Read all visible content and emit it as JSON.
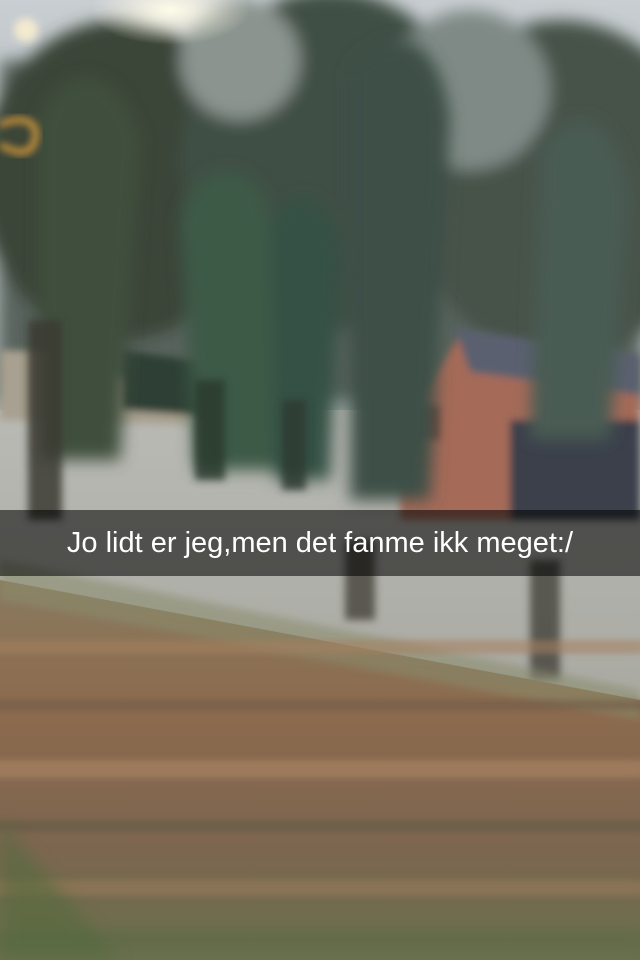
{
  "caption": {
    "text": "Jo lidt er jeg,men det fanme ikk meget:/"
  },
  "photo": {
    "subject": "blurred-outdoor-scene"
  }
}
